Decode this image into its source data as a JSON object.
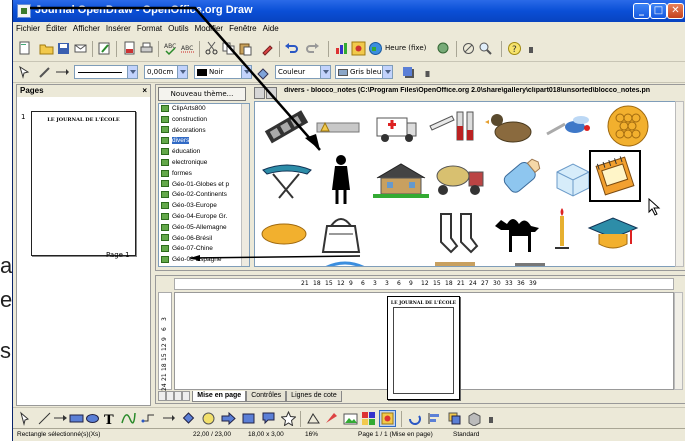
{
  "left_margin_glyphs": [
    "a",
    "e",
    "s"
  ],
  "window": {
    "title": "Journal OpenDraw - OpenOffice.org Draw",
    "controls": {
      "minimize": "_",
      "maximize": "□",
      "close": "✕"
    }
  },
  "menu": [
    "Fichier",
    "Éditer",
    "Afficher",
    "Insérer",
    "Format",
    "Outils",
    "Modifier",
    "Fenêtre",
    "Aide"
  ],
  "toolbar2": {
    "line_width": "0,00cm",
    "line_color": "Noir",
    "area_style": "Couleur",
    "area_color": "Gris bleu",
    "line_style": ""
  },
  "toolbar1": {
    "heure_label": "Heure (fixe)"
  },
  "pages_panel": {
    "title": "Pages",
    "close": "×",
    "page_number": "1",
    "page_title": "LE JOURNAL DE L'ÉCOLE",
    "page_label": "Page 1"
  },
  "gallery": {
    "new_theme_button": "Nouveau thème...",
    "path": "divers - blocco_notes (C:\\Program Files\\OpenOffice.org 2.0\\share\\gallery\\clipart018\\unsorted\\blocco_notes.pn",
    "themes": [
      "ClipArts800",
      "construction",
      "décorations",
      "divers",
      "éducation",
      "electronique",
      "formes",
      "Géo-01-Globes et p",
      "Géo-02-Continents",
      "Géo-03-Europe",
      "Géo-04-Europe Gr.",
      "Géo-05-Allemagne",
      "Géo-06-Brésil",
      "Géo-07-Chine",
      "Géo-08-Espagne"
    ],
    "selected_theme": "divers"
  },
  "drawing": {
    "ruler_labels": [
      "21",
      "18",
      "15",
      "12",
      "9",
      "6",
      "3",
      "3",
      "6",
      "9",
      "12",
      "15",
      "18",
      "21",
      "24",
      "27",
      "30",
      "33",
      "36",
      "39"
    ],
    "vruler_labels": [
      "3",
      "6",
      "9",
      "12",
      "15",
      "18",
      "21",
      "24",
      "27"
    ],
    "page_title": "LE JOURNAL DE L'ÉCOLE",
    "tabs": [
      "Mise en page",
      "Contrôles",
      "Lignes de cote"
    ],
    "active_tab": "Mise en page"
  },
  "status": {
    "left": "Rectangle sélectionné(s)(Xs)",
    "position": "22,00 / 23,00",
    "size": "18,00 x 3,00",
    "zoom": "16%",
    "page": "Page 1 / 1 (Mise en page)",
    "style": "Standard"
  },
  "colors": {
    "title_blue": "#0a4fd6",
    "chrome": "#ece9d8",
    "selection": "#316ac5"
  }
}
